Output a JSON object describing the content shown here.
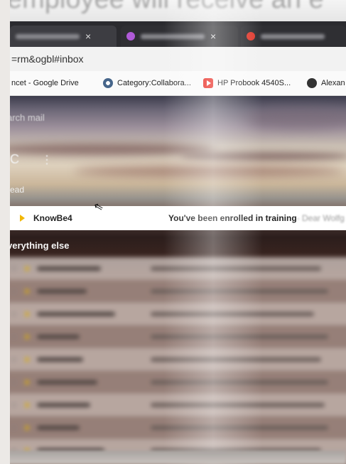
{
  "caption": {
    "text": "employee will receive an e"
  },
  "browser": {
    "tabs": [
      {
        "title": "",
        "close_label": "×"
      },
      {
        "title": "",
        "close_label": "×"
      },
      {
        "title": "",
        "close_label": ""
      }
    ],
    "address": "=rm&ogbl#inbox",
    "bookmarks": [
      {
        "label": "ncet - Google Drive",
        "icon": "none"
      },
      {
        "label": "Category:Collabora...",
        "icon": "gear-icon"
      },
      {
        "label": "HP Probook 4540S...",
        "icon": "youtube-icon"
      },
      {
        "label": "Alexan",
        "icon": "globe-icon"
      }
    ]
  },
  "gmail": {
    "search_label": "arch mail",
    "toolbar_more": "⋮",
    "toolbar_c": "C",
    "section_read": "read",
    "highlighted": {
      "sender": "KnowBe4",
      "subject": "You've been enrolled in training",
      "snippet": "- Dear Wolfg"
    },
    "section_else": "verything else"
  },
  "colors": {
    "importance": "#f2b705",
    "background": "#ffffff"
  }
}
